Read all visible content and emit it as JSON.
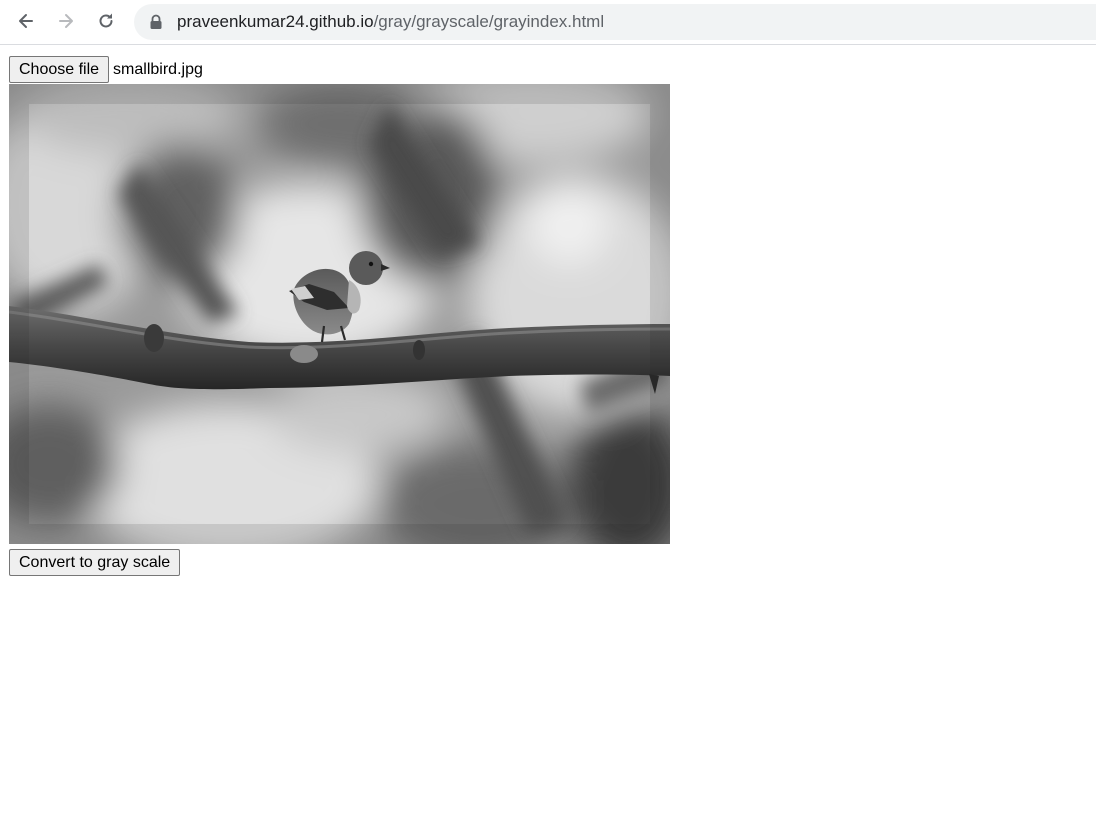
{
  "browser": {
    "url_domain": "praveenkumar24.github.io",
    "url_path": "/gray/grayscale/grayindex.html"
  },
  "file_input": {
    "button_label": "Choose file",
    "file_name": "smallbird.jpg"
  },
  "image": {
    "subject": "bird perched on branch, grayscale"
  },
  "convert_button": {
    "label": "Convert to gray scale"
  }
}
